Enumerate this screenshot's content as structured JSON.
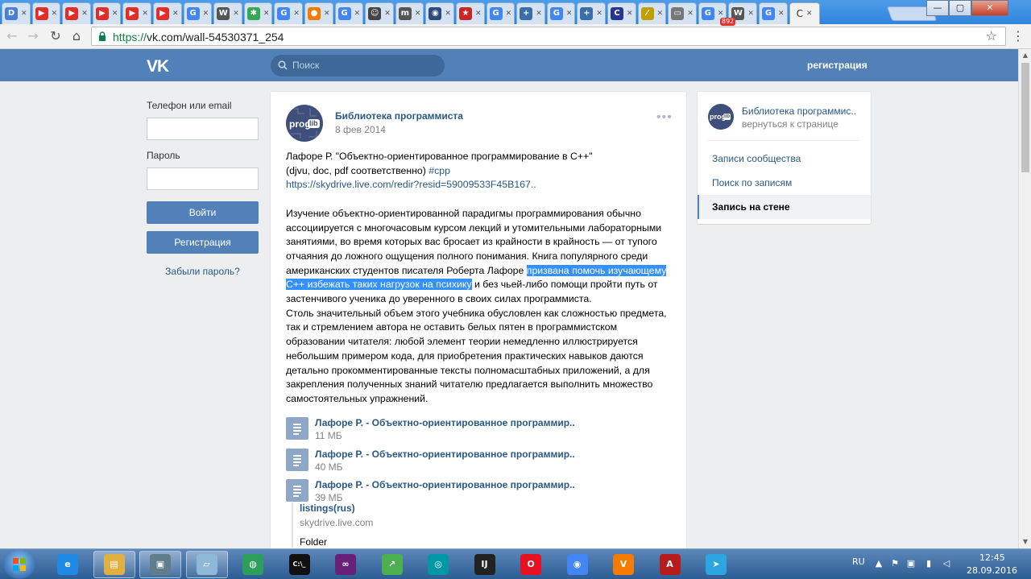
{
  "browser": {
    "tabs": [
      {
        "icon": "docs-icon",
        "color": "#4a7fd6",
        "glyph": "D"
      },
      {
        "icon": "youtube-icon",
        "color": "#e52d27",
        "glyph": "▶"
      },
      {
        "icon": "youtube-icon",
        "color": "#e52d27",
        "glyph": "▶"
      },
      {
        "icon": "youtube-icon",
        "color": "#e52d27",
        "glyph": "▶"
      },
      {
        "icon": "youtube-icon",
        "color": "#e52d27",
        "glyph": "▶"
      },
      {
        "icon": "youtube-icon",
        "color": "#e52d27",
        "glyph": "▶"
      },
      {
        "icon": "google-icon",
        "color": "#4285f4",
        "glyph": "G"
      },
      {
        "icon": "wikipedia-icon",
        "color": "#555555",
        "glyph": "W"
      },
      {
        "icon": "pinwheel-icon",
        "color": "#34a853",
        "glyph": "✱"
      },
      {
        "icon": "google-icon",
        "color": "#4285f4",
        "glyph": "G"
      },
      {
        "icon": "orange-circles-icon",
        "color": "#f57c00",
        "glyph": "●"
      },
      {
        "icon": "google-icon",
        "color": "#4285f4",
        "glyph": "G"
      },
      {
        "icon": "face-icon",
        "color": "#444444",
        "glyph": "☺"
      },
      {
        "icon": "m-icon",
        "color": "#555555",
        "glyph": "m"
      },
      {
        "icon": "shield-icon",
        "color": "#2b4a7e",
        "glyph": "◉"
      },
      {
        "icon": "star-icon",
        "color": "#c62828",
        "glyph": "★"
      },
      {
        "icon": "google-icon",
        "color": "#4285f4",
        "glyph": "G"
      },
      {
        "icon": "plus-icon",
        "color": "#3b6ea8",
        "glyph": "+"
      },
      {
        "icon": "google-icon",
        "color": "#4285f4",
        "glyph": "G"
      },
      {
        "icon": "plus-icon",
        "color": "#3b6ea8",
        "glyph": "+"
      },
      {
        "icon": "cpp-icon",
        "color": "#283593",
        "glyph": "C"
      },
      {
        "icon": "wand-icon",
        "color": "#c0a000",
        "glyph": "⁄"
      },
      {
        "icon": "document-icon",
        "color": "#777777",
        "glyph": "▭"
      },
      {
        "icon": "google-icon",
        "color": "#4285f4",
        "glyph": "G"
      },
      {
        "icon": "wikipedia-icon",
        "color": "#555555",
        "glyph": "W"
      },
      {
        "icon": "google-icon",
        "color": "#4285f4",
        "glyph": "G"
      }
    ],
    "active_tab_glyph": "C",
    "active_tab_close": "✕",
    "tab_close": "✕",
    "url_scheme": "https://",
    "url_rest": "vk.com/wall-54530371_254",
    "window": {
      "minimize": "—",
      "maximize": "▢",
      "close": "✕"
    }
  },
  "vk": {
    "logo": "VK",
    "search_placeholder": "Поиск",
    "register_link": "регистрация"
  },
  "login": {
    "phone_label": "Телефон или email",
    "password_label": "Пароль",
    "login_button": "Войти",
    "register_button": "Регистрация",
    "forgot_link": "Забыли пароль?"
  },
  "post": {
    "avatar_text": "prog",
    "avatar_badge": "lib",
    "author": "Библиотека программиста",
    "date": "8 фев 2014",
    "more": "•••",
    "line1": "Лафоре Р. \"Объектно-ориентированное программирование в C++\"",
    "line2_text": "(djvu, doc, pdf соответственно) ",
    "hashtag": "#cpp",
    "link": "https://skydrive.live.com/redir?resid=59009533F45B167..",
    "para1_before": "Изучение объектно-ориентированной парадигмы программирования обычно ассоциируется с многочасовым курсом лекций и утомительными лабораторными занятиями, во время которых вас бросает из крайности в крайность — от тупого отчаяния до ложного ощущения полного понимания. Книга популярного среди американских студентов писателя Роберта Лафоре ",
    "para1_highlight": "призвана помочь изучающему C++ избежать таких нагрузок на психику",
    "para1_after": " и без чьей-либо помощи пройти путь от застенчивого ученика до уверенного в своих силах программиста.",
    "para2": "Столь значительный объем этого учебника обусловлен как сложностью предмета, так и стремлением автора не оставить белых пятен в программистском образовании читателя: любой элемент теории немедленно иллюстрируется небольшим примером кода, для приобретения практических навыков даются детально прокомментированные тексты полномасштабных приложений, а для закрепления полученных знаний читателю предлагается выполнить множество самостоятельных упражнений.",
    "docs": [
      {
        "title": "Лафоре Р. - Объектно-ориентированное программир..",
        "size": "11 МБ"
      },
      {
        "title": "Лафоре Р. - Объектно-ориентированное программир..",
        "size": "40 МБ"
      },
      {
        "title": "Лафоре Р. - Объектно-ориентированное программир..",
        "size": "39 МБ"
      }
    ],
    "link_attachment": {
      "title": "listings(rus)",
      "host": "skydrive.live.com",
      "type": "Folder"
    }
  },
  "sidebar": {
    "group_name": "Библиотека программис..",
    "back": "вернуться к странице",
    "items": [
      {
        "label": "Записи сообщества"
      },
      {
        "label": "Поиск по записям"
      },
      {
        "label": "Запись на стене"
      }
    ]
  },
  "taskbar": {
    "items": [
      {
        "icon": "ie-icon",
        "color": "#1e88e5",
        "glyph": "e"
      },
      {
        "icon": "file-explorer-icon",
        "color": "#e0b040",
        "glyph": "▤"
      },
      {
        "icon": "monitor-icon",
        "color": "#607d8b",
        "glyph": "▣"
      },
      {
        "icon": "notepad-icon",
        "color": "#8fb8d8",
        "glyph": "▱"
      },
      {
        "icon": "globe-icon",
        "color": "#2e9e5b",
        "glyph": "◍"
      },
      {
        "icon": "console-icon",
        "color": "#111111",
        "glyph": "C:\\_"
      },
      {
        "icon": "visual-studio-icon",
        "color": "#68217a",
        "glyph": "∞"
      },
      {
        "icon": "chart-app-icon",
        "color": "#4caf50",
        "glyph": "↗"
      },
      {
        "icon": "teal-circle-icon",
        "color": "#0097a7",
        "glyph": "◎"
      },
      {
        "icon": "intellij-icon",
        "color": "#222222",
        "glyph": "IJ"
      },
      {
        "icon": "opera-icon",
        "color": "#e81123",
        "glyph": "O"
      },
      {
        "icon": "chrome-icon",
        "color": "#4285f4",
        "glyph": "◉"
      },
      {
        "icon": "v-app-icon",
        "color": "#f57c00",
        "glyph": "V"
      },
      {
        "icon": "pdf-reader-icon",
        "color": "#b71c1c",
        "glyph": "A"
      },
      {
        "icon": "telegram-icon",
        "color": "#2ca5e0",
        "glyph": "➤"
      }
    ],
    "telegram_badge": "892",
    "lang": "RU",
    "clock_time": "12:45",
    "clock_date": "28.09.2016"
  }
}
